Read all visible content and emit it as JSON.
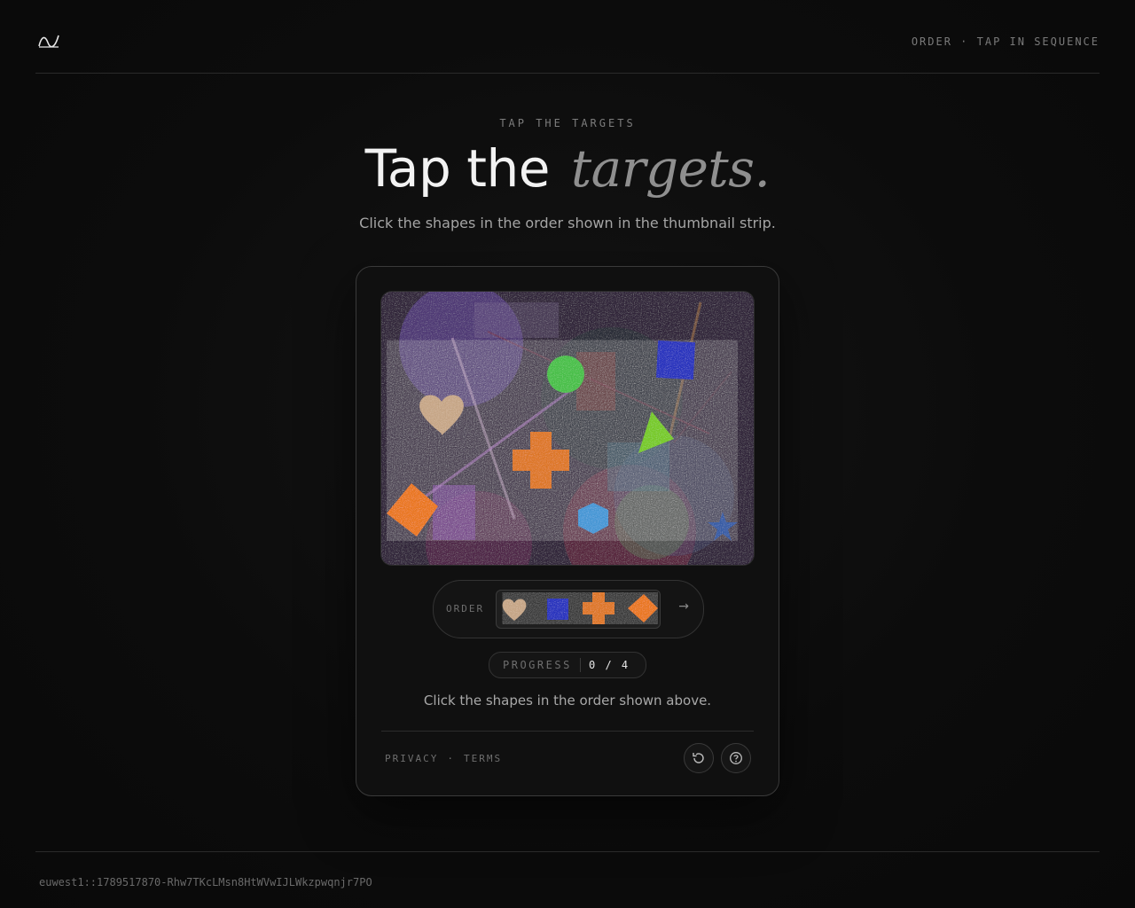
{
  "header": {
    "tagline": "ORDER · TAP IN SEQUENCE",
    "logo_icon": "wave-logo-icon"
  },
  "hero": {
    "eyebrow": "TAP THE TARGETS",
    "title_plain": "Tap the",
    "title_accent": "targets.",
    "subtitle": "Click the shapes in the order shown in the thumbnail strip."
  },
  "challenge": {
    "canvas_shapes": [
      "heart",
      "square",
      "circle",
      "triangle",
      "cross",
      "diamond",
      "hexagon",
      "star"
    ],
    "order": {
      "label": "ORDER",
      "thumbnails": [
        "heart",
        "square",
        "cross",
        "diamond"
      ],
      "arrow": "→"
    },
    "progress": {
      "label": "PROGRESS",
      "value": "0 / 4"
    },
    "instruction": "Click the shapes in the order shown above.",
    "links": [
      "PRIVACY",
      "·",
      "TERMS"
    ],
    "buttons": {
      "refresh_icon": "refresh-icon",
      "help_icon": "help-icon"
    }
  },
  "colors": {
    "heart": "#c9a98a",
    "square": "#2a35c0",
    "circle": "#4cc24c",
    "triangle": "#7acc2c",
    "cross": "#e07a2a",
    "diamond": "#ec7a24",
    "hexagon": "#4a9ad8",
    "star": "#3a5fa8"
  },
  "footer": {
    "session_id": "euwest1::1789517870-Rhw7TKcLMsn8HtWVwIJLWkzpwqnjr7PO"
  }
}
